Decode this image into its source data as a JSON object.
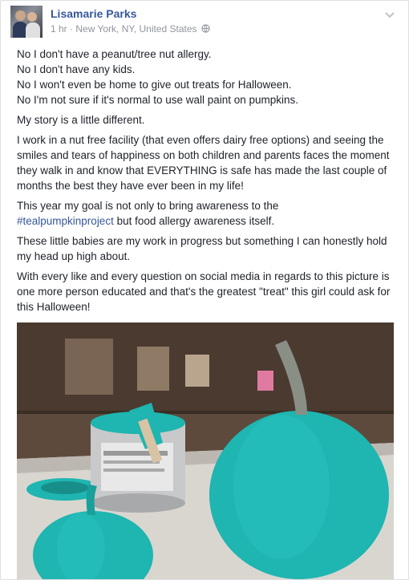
{
  "post": {
    "author_name": "Lisamarie Parks",
    "time": "1 hr",
    "separator": " · ",
    "location": "New York, NY, United States",
    "paragraphs": [
      [
        "No I don't have a peanut/tree nut allergy.",
        "No I don't have any kids.",
        "No I won't even be home to give out treats for Halloween.",
        "No I'm not sure if it's normal to use wall paint on pumpkins."
      ],
      [
        "My story is a little different."
      ],
      [
        "I work in a nut free facility (that even offers dairy free options) and seeing the smiles and tears of happiness on both children and parents faces the moment they walk in and know that EVERYTHING is safe has made the last couple of months the best they have ever been in my life!"
      ]
    ],
    "awareness_before": "This year my goal is not only to bring awareness to the",
    "hashtag": "#tealpumpkinproject",
    "awareness_after": " but food allergy awareness itself.",
    "paragraph_babies": "These little babies are my work in progress but something I can honestly hold my head up high about.",
    "paragraph_closing": "With every like and every question on social media in regards to this picture is one more person educated and that's the greatest \"treat\" this girl could ask for this Halloween!"
  },
  "icons": {
    "globe": "globe-icon",
    "chevron": "chevron-down-icon"
  },
  "colors": {
    "author_link": "#365899",
    "meta_text": "#90949c",
    "teal_paint": "#1fb5b0"
  }
}
